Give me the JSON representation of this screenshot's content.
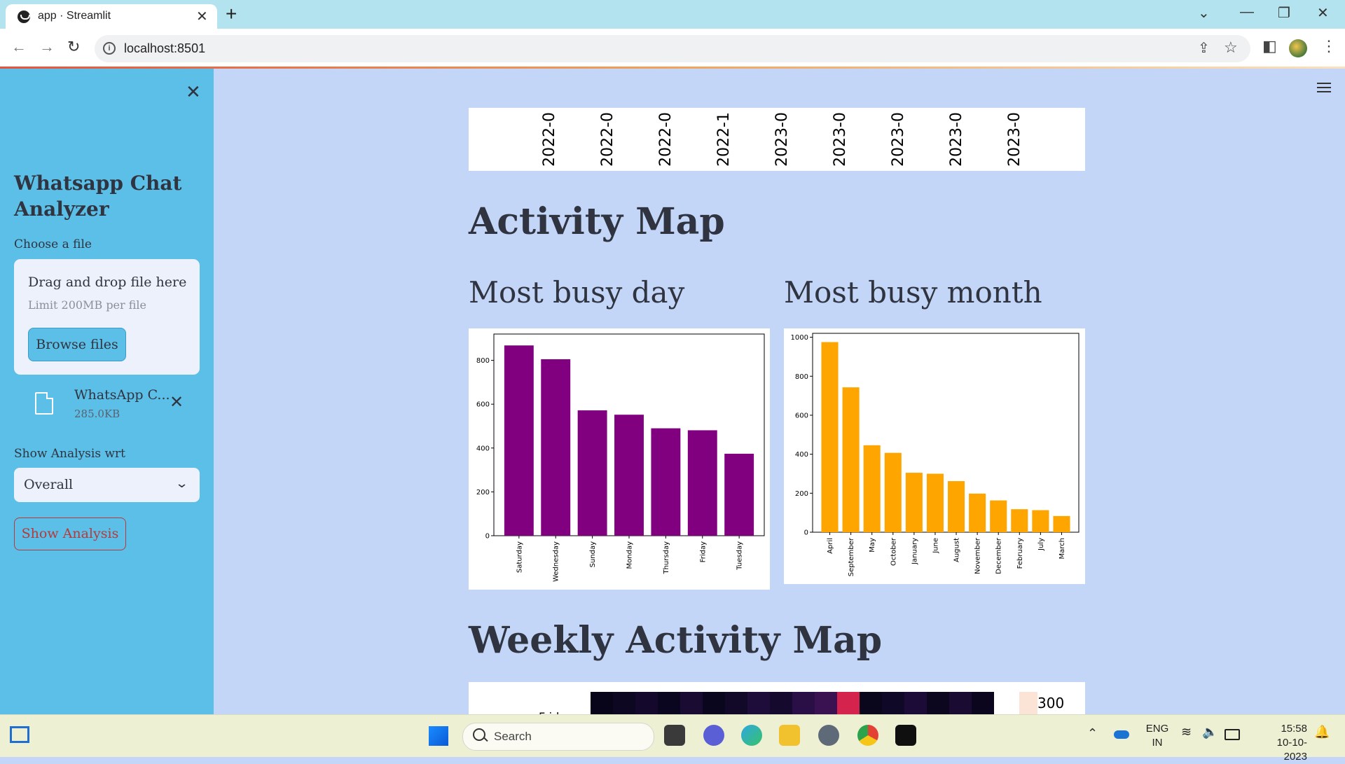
{
  "browser": {
    "tab_title": "app · Streamlit",
    "url": "localhost:8501"
  },
  "sidebar": {
    "title": "Whatsapp Chat Analyzer",
    "file_label": "Choose a file",
    "dropzone_text": "Drag and drop file here",
    "dropzone_limit": "Limit 200MB per file",
    "browse_label": "Browse files",
    "uploaded_file_name": "WhatsApp C...",
    "uploaded_file_size": "285.0KB",
    "analysis_label": "Show Analysis wrt",
    "analysis_selected": "Overall",
    "show_button": "Show Analysis"
  },
  "main": {
    "timeline_ticks": [
      "2022-0",
      "2022-0",
      "2022-0",
      "2022-1",
      "2023-0",
      "2023-0",
      "2023-0",
      "2023-0",
      "2023-0"
    ],
    "activity_title": "Activity Map",
    "busy_day_title": "Most busy day",
    "busy_month_title": "Most busy month",
    "weekly_title": "Weekly Activity Map",
    "heatmap_row_label": "Friday",
    "heatmap_colorbar_label": "300"
  },
  "chart_data": [
    {
      "type": "bar",
      "title": "Most busy day",
      "categories": [
        "Saturday",
        "Wednesday",
        "Sunday",
        "Monday",
        "Thursday",
        "Friday",
        "Tuesday"
      ],
      "values": [
        868,
        805,
        572,
        552,
        490,
        481,
        374
      ],
      "ylim": [
        0,
        920
      ],
      "yticks": [
        0,
        200,
        400,
        600,
        800
      ],
      "color": "#800080"
    },
    {
      "type": "bar",
      "title": "Most busy month",
      "categories": [
        "April",
        "September",
        "May",
        "October",
        "January",
        "June",
        "August",
        "November",
        "December",
        "February",
        "July",
        "March"
      ],
      "values": [
        975,
        743,
        446,
        407,
        305,
        300,
        262,
        198,
        163,
        118,
        113,
        83
      ],
      "ylim": [
        0,
        1020
      ],
      "yticks": [
        0,
        200,
        400,
        600,
        800,
        1000
      ],
      "color": "#ffa500"
    }
  ],
  "taskbar": {
    "search_placeholder": "Search",
    "lang_line1": "ENG",
    "lang_line2": "IN",
    "time": "15:58",
    "date": "10-10-2023"
  }
}
